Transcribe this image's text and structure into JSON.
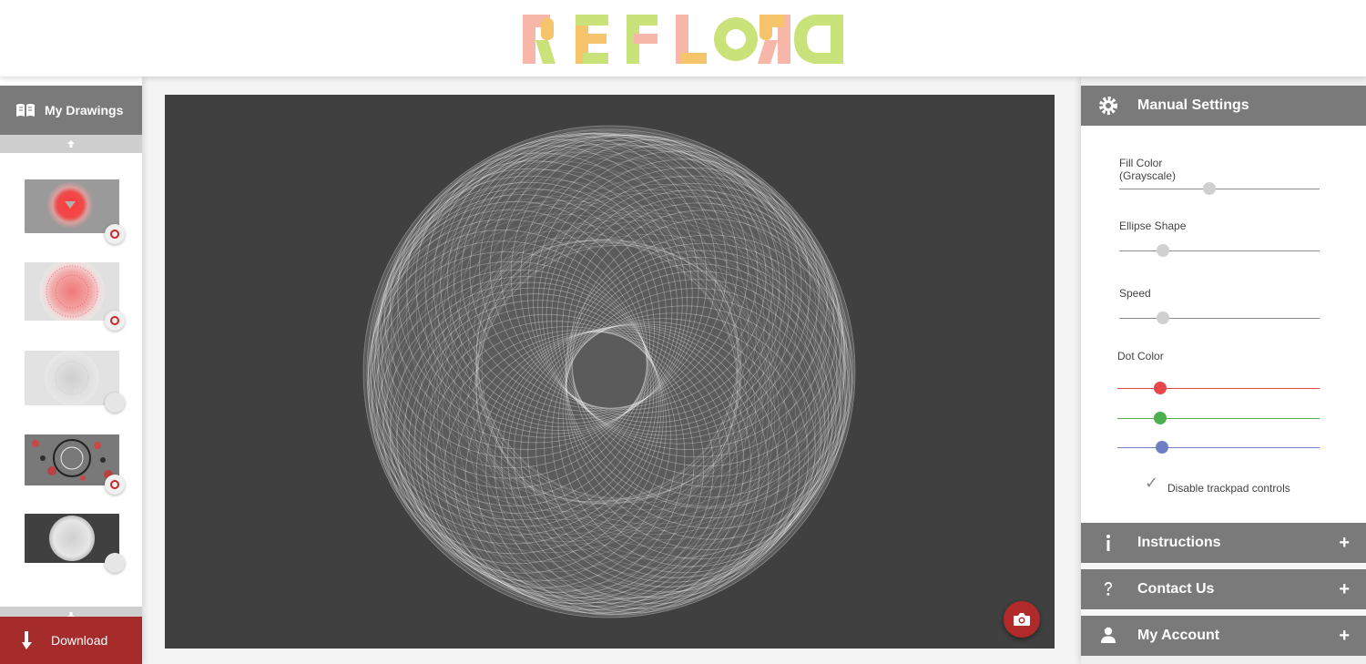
{
  "header": {
    "logo_text": "REFLORD"
  },
  "left_sidebar": {
    "title": "My Drawings",
    "title_icon": "book-icon",
    "scroll_up_icon": "arrow-up-icon",
    "scroll_down_icon": "arrow-down-icon",
    "thumbnails": [
      {
        "style": "red-gray",
        "badge": "record"
      },
      {
        "style": "pink-light",
        "badge": "record"
      },
      {
        "style": "gray-light",
        "badge": "plain"
      },
      {
        "style": "noisy-red",
        "badge": "record"
      },
      {
        "style": "dark-circle",
        "badge": "plain"
      }
    ],
    "download_label": "Download",
    "download_icon": "arrow-down-icon"
  },
  "canvas": {
    "background": "#404040",
    "camera_icon": "camera-icon"
  },
  "right_panel": {
    "manual_settings": {
      "title": "Manual Settings",
      "icon": "gear-icon",
      "fill_color_label_1": "Fill Color",
      "fill_color_label_2": "(Grayscale)",
      "ellipse_shape_label": "Ellipse Shape",
      "speed_label": "Speed",
      "dot_color_label": "Dot Color",
      "disable_trackpad_label": "Disable trackpad controls",
      "sliders": {
        "fill_color": 0.45,
        "ellipse_shape": 0.22,
        "speed": 0.22,
        "dot_red": 0.21,
        "dot_green": 0.21,
        "dot_blue": 0.22
      },
      "dot_colors": {
        "red": "#e8474a",
        "green": "#4caf50",
        "blue": "#6f7fc4"
      }
    },
    "sections": [
      {
        "title": "Instructions",
        "icon": "info-icon",
        "action": "+"
      },
      {
        "title": "Contact Us",
        "icon": "question-icon",
        "action": "+"
      },
      {
        "title": "My Account",
        "icon": "user-icon",
        "action": "+"
      }
    ]
  },
  "colors": {
    "header_bg": "#ffffff",
    "panel_head_bg": "#7a7a7a",
    "download_bg": "#a62b2b",
    "camera_bg": "#b02a2a"
  }
}
